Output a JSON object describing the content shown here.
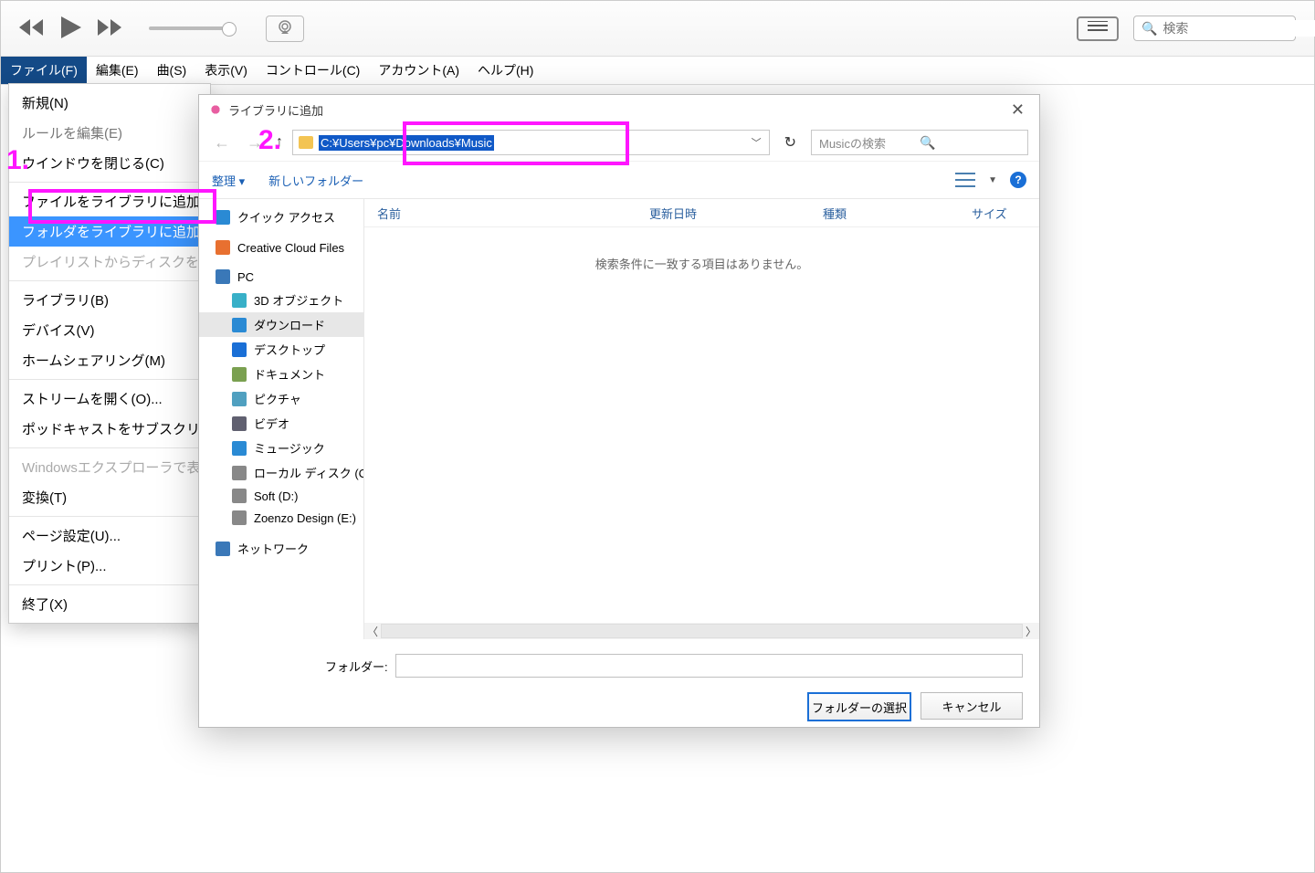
{
  "win_controls": {
    "min": "—",
    "max": "☐",
    "close": "✕"
  },
  "search_placeholder": "検索",
  "menubar": [
    "ファイル(F)",
    "編集(E)",
    "曲(S)",
    "表示(V)",
    "コントロール(C)",
    "アカウント(A)",
    "ヘルプ(H)"
  ],
  "file_menu": {
    "items": [
      {
        "label": "新規(N)"
      },
      {
        "label": "ルールを編集(E)",
        "sub": true
      },
      {
        "label": "ウインドウを閉じる(C)"
      },
      {
        "sep": true
      },
      {
        "label": "ファイルをライブラリに追加(A"
      },
      {
        "label": "フォルダをライブラリに追加(D",
        "hl": true
      },
      {
        "label": "プレイリストからディスクを作",
        "dis": true
      },
      {
        "sep": true
      },
      {
        "label": "ライブラリ(B)"
      },
      {
        "label": "デバイス(V)"
      },
      {
        "label": "ホームシェアリング(M)"
      },
      {
        "sep": true
      },
      {
        "label": "ストリームを開く(O)..."
      },
      {
        "label": "ポッドキャストをサブスクリプ"
      },
      {
        "sep": true
      },
      {
        "label": "Windowsエクスプローラで表",
        "dis": true
      },
      {
        "label": "変換(T)"
      },
      {
        "sep": true
      },
      {
        "label": "ページ設定(U)..."
      },
      {
        "label": "プリント(P)..."
      },
      {
        "sep": true
      },
      {
        "label": "終了(X)"
      }
    ]
  },
  "dialog": {
    "title": "ライブラリに追加",
    "close": "✕",
    "path": "C:¥Users¥pc¥Downloads¥Music",
    "search_placeholder": "Musicの検索",
    "toolbar": {
      "organize": "整理 ▾",
      "newfolder": "新しいフォルダー"
    },
    "columns": {
      "name": "名前",
      "date": "更新日時",
      "type": "種類",
      "size": "サイズ"
    },
    "empty": "検索条件に一致する項目はありません。",
    "tree": [
      {
        "label": "クイック アクセス",
        "icon": "star",
        "color": "#2a8ad4"
      },
      {
        "label": "Creative Cloud Files",
        "icon": "cc",
        "color": "#e87030"
      },
      {
        "label": "PC",
        "icon": "pc",
        "color": "#3a78b8",
        "children": [
          {
            "label": "3D オブジェクト",
            "color": "#38b0c8"
          },
          {
            "label": "ダウンロード",
            "color": "#2a8ad4",
            "sel": true
          },
          {
            "label": "デスクトップ",
            "color": "#1a6fd6"
          },
          {
            "label": "ドキュメント",
            "color": "#7aa050"
          },
          {
            "label": "ピクチャ",
            "color": "#50a0c0"
          },
          {
            "label": "ビデオ",
            "color": "#606070"
          },
          {
            "label": "ミュージック",
            "color": "#2a8ad4"
          },
          {
            "label": "ローカル ディスク (C:)",
            "color": "#888"
          },
          {
            "label": "Soft (D:)",
            "color": "#888"
          },
          {
            "label": "Zoenzo Design (E:)",
            "color": "#888"
          }
        ]
      },
      {
        "label": "ネットワーク",
        "icon": "net",
        "color": "#3a78b8"
      }
    ],
    "folder_label": "フォルダー:",
    "folder_value": "",
    "ok": "フォルダーの選択",
    "cancel": "キャンセル"
  },
  "annotations": {
    "one": "1.",
    "two": "2."
  }
}
